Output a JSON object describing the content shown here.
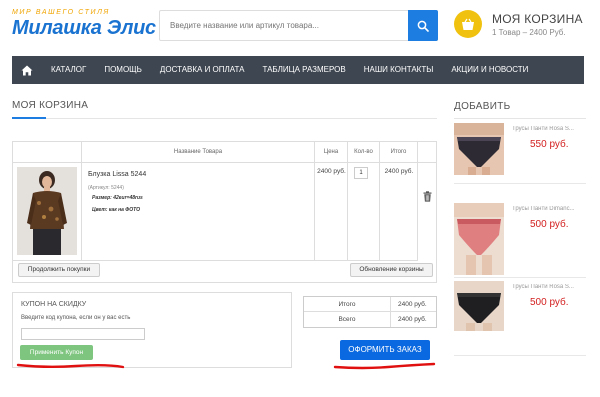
{
  "header": {
    "logo_tagline": "МИР ВАШЕГО СТИЛЯ",
    "logo_name": "Милашка Элис",
    "search_placeholder": "Введите название или артикул товара...",
    "cart_title": "МОЯ КОРЗИНА",
    "cart_summary": "1 Товар – 2400 Руб."
  },
  "nav": {
    "items": [
      "КАТАЛОГ",
      "ПОМОЩЬ",
      "ДОСТАВКА И ОПЛАТА",
      "ТАБЛИЦА РАЗМЕРОВ",
      "НАШИ КОНТАКТЫ",
      "АКЦИИ И НОВОСТИ"
    ]
  },
  "page": {
    "title": "МОЯ КОРЗИНА",
    "side_title": "ДОБАВИТЬ"
  },
  "cart": {
    "columns": [
      "Название Товара",
      "Цена",
      "Кол-во",
      "Итого"
    ],
    "item": {
      "name": "Блузка Lissa 5244",
      "article": "(Артикул: 5244)",
      "size": "Размер: 42eur=48rus",
      "color": "Цвет: как на ФОТО",
      "price": "2400 руб.",
      "qty": "1",
      "total": "2400 руб."
    },
    "continue_label": "Продолжить покупки",
    "update_label": "Обновление корзины"
  },
  "coupon": {
    "title": "КУПОН НА СКИДКУ",
    "hint": "Введите код купона, если он у вас есть",
    "apply_label": "Применить Купон"
  },
  "totals": {
    "subtotal_label": "Итого",
    "subtotal_value": "2400 руб.",
    "total_label": "Всего",
    "total_value": "2400 руб.",
    "checkout_label": "ОФОРМИТЬ ЗАКАЗ"
  },
  "sidebar": {
    "products": [
      {
        "name": "Трусы Панти Rosa S...",
        "price": "550 руб."
      },
      {
        "name": "Трусы Панти Dimanc...",
        "price": "500 руб."
      },
      {
        "name": "Трусы Панти Rosa S...",
        "price": "500 руб."
      }
    ]
  },
  "colors": {
    "accent": "#1e7de0",
    "nav_bg": "#3e4651",
    "checkout": "#0a69e0",
    "coupon_btn": "#7ec57f",
    "price_red": "#d32020",
    "annotation_red": "#e01010"
  }
}
